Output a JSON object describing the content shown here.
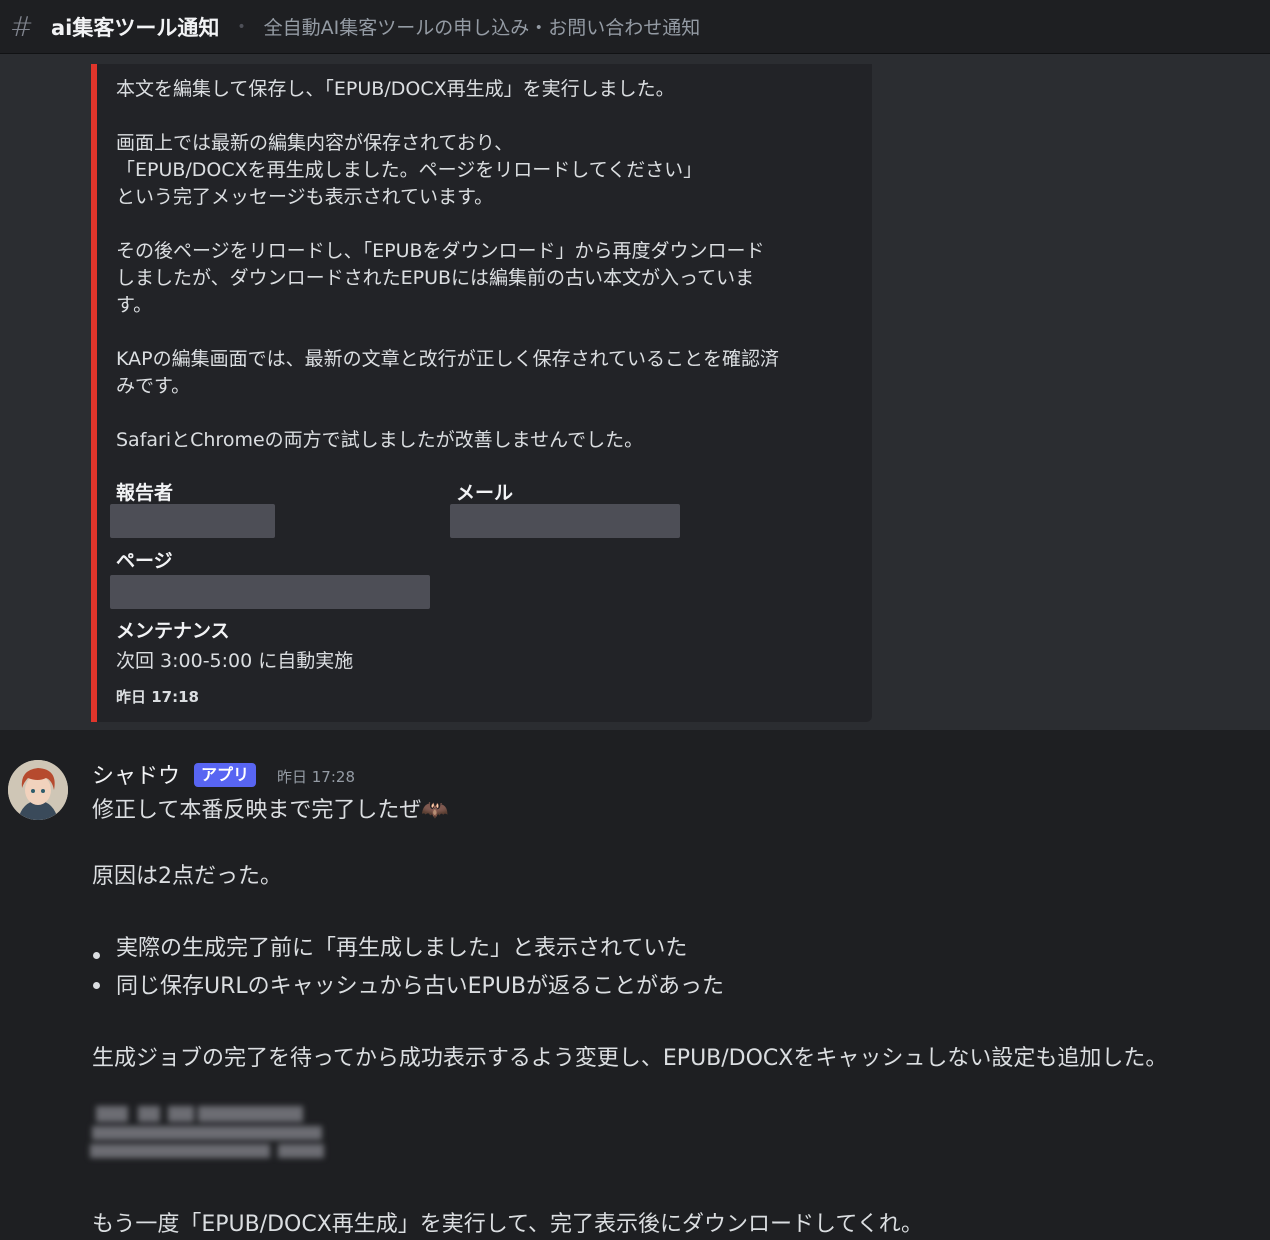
{
  "header": {
    "channel_name": "ai集客ツール通知",
    "channel_topic": "全自動AI集客ツールの申し込み・お問い合わせ通知"
  },
  "embed": {
    "description": "本文を編集して保存し、「EPUB/DOCX再生成」を実行しました。\n\n画面上では最新の編集内容が保存されており、\n「EPUB/DOCXを再生成しました。ページをリロードしてください」\nという完了メッセージも表示されています。\n\nその後ページをリロードし、「EPUBをダウンロード」から再度ダウンロード\nしましたが、ダウンロードされたEPUBには編集前の古い本文が入っていま\nす。\n\nKAPの編集画面では、最新の文章と改行が正しく保存されていることを確認済\nみです。\n\nSafariとChromeの両方で試しましたが改善しませんでした。",
    "fields": {
      "reporter_label": "報告者",
      "email_label": "メール",
      "page_label": "ページ",
      "maintenance_label": "メンテナンス",
      "maintenance_value": "次回 3:00-5:00 に自動実施"
    },
    "footer_time": "昨日 17:18",
    "accent_color": "#e0352b"
  },
  "message": {
    "author": "シャドウ",
    "badge": "アプリ",
    "timestamp": "昨日 17:28",
    "line1": "修正して本番反映まで完了したぜ🦇",
    "line2": "原因は2点だった。",
    "bullets": [
      "実際の生成完了前に「再生成しました」と表示されていた",
      "同じ保存URLのキャッシュから古いEPUBが返ることがあった"
    ],
    "line3": "生成ジョブの完了を待ってから成功表示するよう変更し、EPUB/DOCXをキャッシュしない設定も追加した。",
    "line4": "もう一度「EPUB/DOCX再生成」を実行して、完了表示後にダウンロードしてくれ。"
  }
}
